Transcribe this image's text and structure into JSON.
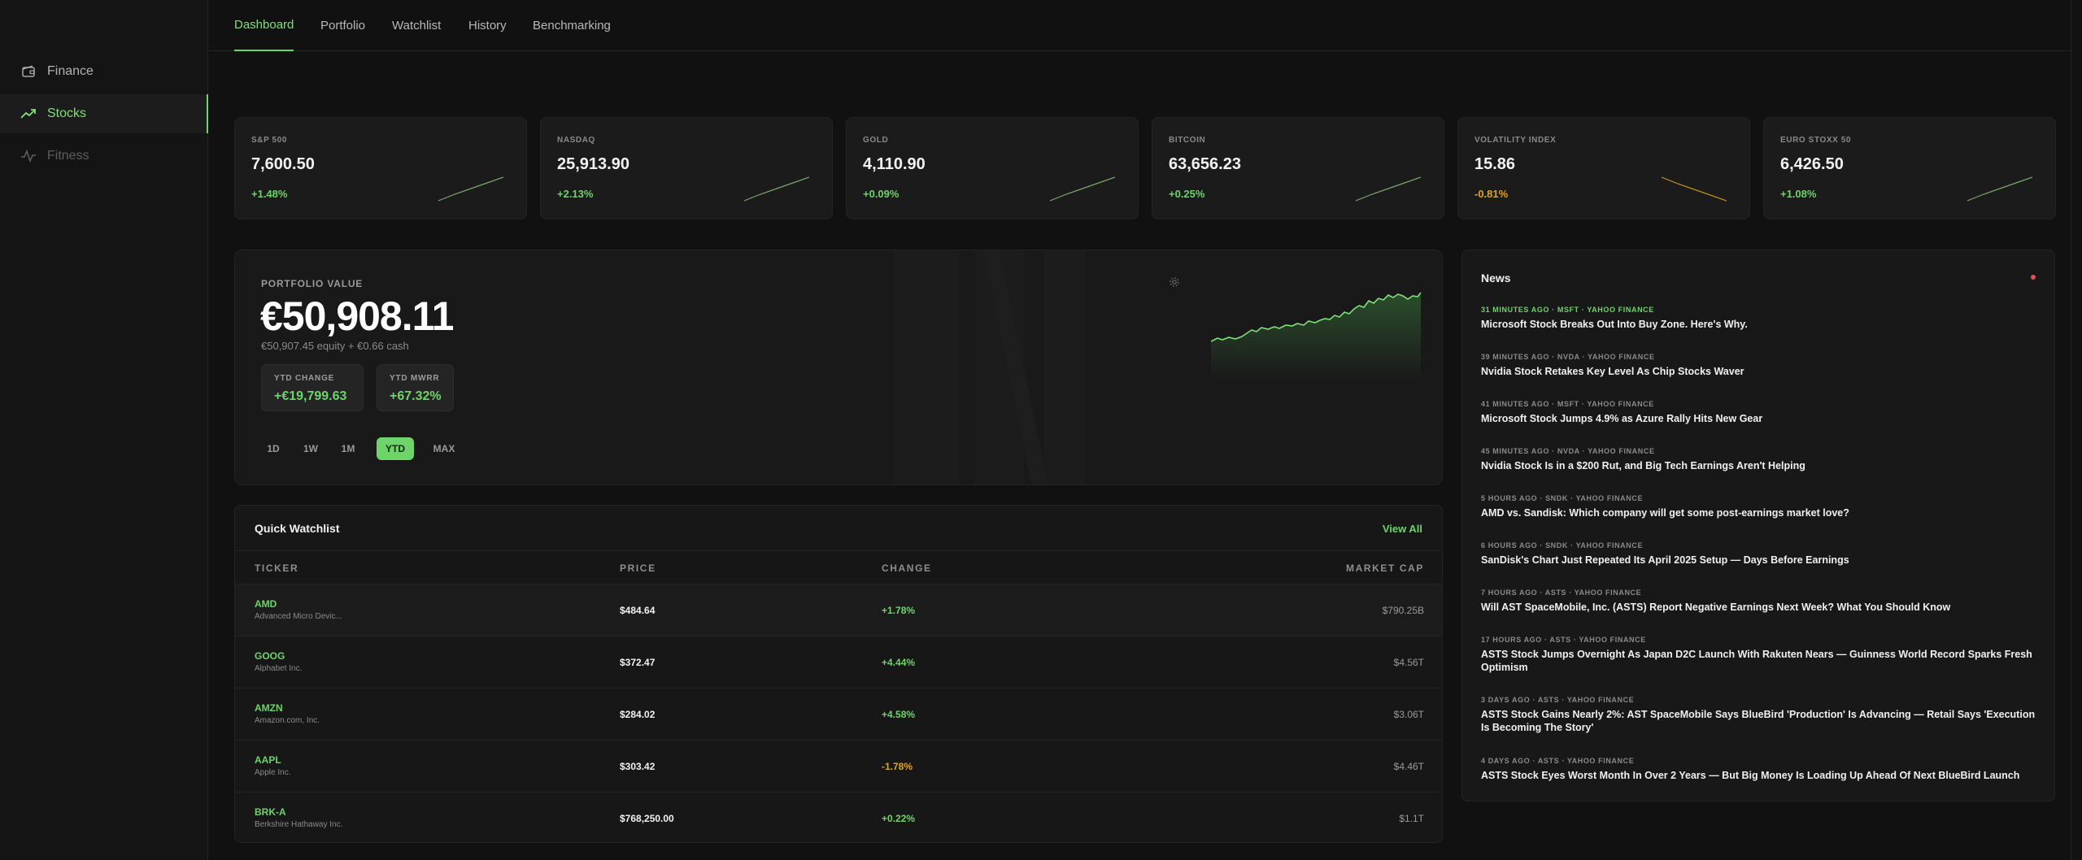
{
  "sidebar": {
    "items": [
      {
        "label": "Finance",
        "icon": "wallet-icon"
      },
      {
        "label": "Stocks",
        "icon": "trending-up-icon"
      },
      {
        "label": "Fitness",
        "icon": "activity-icon"
      }
    ]
  },
  "nav": {
    "tabs": [
      "Dashboard",
      "Portfolio",
      "Watchlist",
      "History",
      "Benchmarking"
    ]
  },
  "indices": [
    {
      "label": "S&P 500",
      "value": "7,600.50",
      "change": "+1.48%",
      "trend": "up"
    },
    {
      "label": "NASDAQ",
      "value": "25,913.90",
      "change": "+2.13%",
      "trend": "up"
    },
    {
      "label": "GOLD",
      "value": "4,110.90",
      "change": "+0.09%",
      "trend": "up"
    },
    {
      "label": "BITCOIN",
      "value": "63,656.23",
      "change": "+0.25%",
      "trend": "up"
    },
    {
      "label": "VOLATILITY INDEX",
      "value": "15.86",
      "change": "-0.81%",
      "trend": "down"
    },
    {
      "label": "EURO STOXX 50",
      "value": "6,426.50",
      "change": "+1.08%",
      "trend": "up"
    }
  ],
  "portfolio": {
    "label": "PORTFOLIO VALUE",
    "value": "€50,908.11",
    "sub": "€50,907.45 equity + €0.66 cash",
    "ytd_change_label": "YTD CHANGE",
    "ytd_change": "+€19,799.63",
    "ytd_mwrr_label": "YTD MWRR",
    "ytd_mwrr": "+67.32%",
    "ranges": [
      "1D",
      "1W",
      "1M",
      "YTD",
      "MAX"
    ],
    "active_range": "YTD"
  },
  "watchlist": {
    "title": "Quick Watchlist",
    "view_all": "View All",
    "columns": [
      "TICKER",
      "PRICE",
      "CHANGE",
      "MARKET CAP"
    ],
    "rows": [
      {
        "ticker": "AMD",
        "name": "Advanced Micro Devic...",
        "price": "$484.64",
        "change": "+1.78%",
        "cap": "$790.25B",
        "trend": "up"
      },
      {
        "ticker": "GOOG",
        "name": "Alphabet Inc.",
        "price": "$372.47",
        "change": "+4.44%",
        "cap": "$4.56T",
        "trend": "up"
      },
      {
        "ticker": "AMZN",
        "name": "Amazon.com, Inc.",
        "price": "$284.02",
        "change": "+4.58%",
        "cap": "$3.06T",
        "trend": "up"
      },
      {
        "ticker": "AAPL",
        "name": "Apple Inc.",
        "price": "$303.42",
        "change": "-1.78%",
        "cap": "$4.46T",
        "trend": "down"
      },
      {
        "ticker": "BRK-A",
        "name": "Berkshire Hathaway Inc.",
        "price": "$768,250.00",
        "change": "+0.22%",
        "cap": "$1.1T",
        "trend": "up"
      }
    ]
  },
  "news": {
    "title": "News",
    "items": [
      {
        "meta": "31 MINUTES AGO · MSFT · YAHOO FINANCE",
        "headline": "Microsoft Stock Breaks Out Into Buy Zone. Here's Why."
      },
      {
        "meta": "39 MINUTES AGO · NVDA · YAHOO FINANCE",
        "headline": "Nvidia Stock Retakes Key Level As Chip Stocks Waver"
      },
      {
        "meta": "41 MINUTES AGO · MSFT · YAHOO FINANCE",
        "headline": "Microsoft Stock Jumps 4.9% as Azure Rally Hits New Gear"
      },
      {
        "meta": "45 MINUTES AGO · NVDA · YAHOO FINANCE",
        "headline": "Nvidia Stock Is in a $200 Rut, and Big Tech Earnings Aren't Helping"
      },
      {
        "meta": "5 HOURS AGO · SNDK · YAHOO FINANCE",
        "headline": "AMD vs. Sandisk: Which company will get some post-earnings market love?"
      },
      {
        "meta": "6 HOURS AGO · SNDK · YAHOO FINANCE",
        "headline": "SanDisk's Chart Just Repeated Its April 2025 Setup — Days Before Earnings"
      },
      {
        "meta": "7 HOURS AGO · ASTS · YAHOO FINANCE",
        "headline": "Will AST SpaceMobile, Inc. (ASTS) Report Negative Earnings Next Week? What You Should Know"
      },
      {
        "meta": "17 HOURS AGO · ASTS · YAHOO FINANCE",
        "headline": "ASTS Stock Jumps Overnight As Japan D2C Launch With Rakuten Nears — Guinness World Record Sparks Fresh Optimism"
      },
      {
        "meta": "3 DAYS AGO · ASTS · YAHOO FINANCE",
        "headline": "ASTS Stock Gains Nearly 2%: AST SpaceMobile Says BlueBird 'Production' Is Advancing — Retail Says 'Execution Is Becoming The Story'"
      },
      {
        "meta": "4 DAYS AGO · ASTS · YAHOO FINANCE",
        "headline": "ASTS Stock Eyes Worst Month In Over 2 Years — But Big Money Is Loading Up Ahead Of Next BlueBird Launch"
      }
    ]
  },
  "colors": {
    "accent": "#6dd46a",
    "negative": "#e0a325",
    "background": "#111111",
    "panel": "#1b1b1b",
    "alert": "#e05252"
  }
}
